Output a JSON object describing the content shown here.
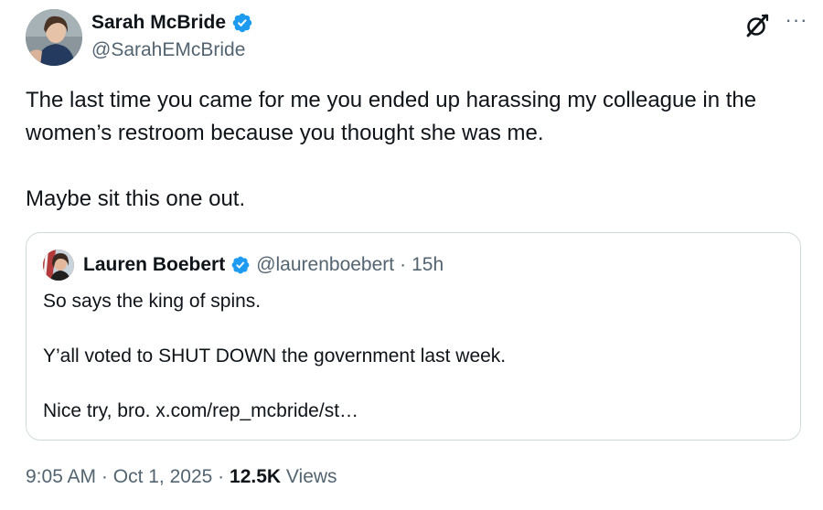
{
  "tweet": {
    "author": {
      "display_name": "Sarah McBride",
      "handle": "@SarahEMcBride",
      "verified_icon": "verified-badge-icon",
      "avatar_icon": "avatar"
    },
    "text": "The last time you came for me you ended up harassing my colleague in the women’s restroom because you thought she was me.\n\nMaybe sit this one out.",
    "actions": {
      "grok_icon": "grok-icon",
      "more_label": "···"
    },
    "quote": {
      "display_name": "Lauren Boebert",
      "handle": "@laurenboebert",
      "separator": "·",
      "time": "15h",
      "text": "So says the king of spins.\n\nY’all voted to SHUT DOWN the government last week.\n\nNice try, bro. x.com/rep_mcbride/st…"
    },
    "meta": {
      "time": "9:05 AM",
      "sep1": "·",
      "date": "Oct 1, 2025",
      "sep2": "·",
      "views_count": "12.5K",
      "views_label": "Views"
    }
  },
  "colors": {
    "text_primary": "#0f1419",
    "text_secondary": "#536471",
    "verified_blue": "#1d9bf0",
    "border": "#cfd9de"
  }
}
